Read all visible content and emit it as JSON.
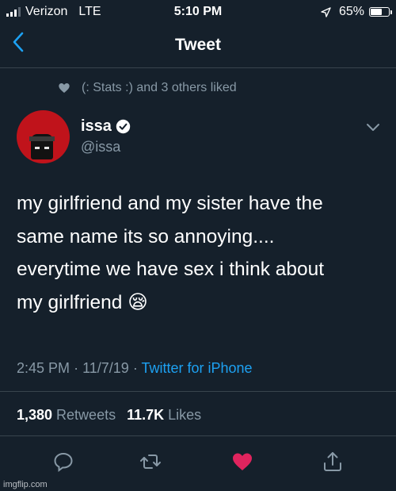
{
  "status_bar": {
    "carrier": "Verizon",
    "network": "LTE",
    "time": "5:10 PM",
    "battery_percent": "65%",
    "battery_level": 0.65
  },
  "nav": {
    "title": "Tweet",
    "back_icon": "chevron-left-icon"
  },
  "social_context": {
    "icon": "heart-icon",
    "text": "(: Stats :) and 3 others liked"
  },
  "author": {
    "name": "issa",
    "handle": "@issa",
    "verified": true,
    "avatar_bg": "#c0131b"
  },
  "tweet": {
    "lines": [
      "my girlfriend and my sister have the",
      "same name its so annoying....",
      "everytime we have sex i think about",
      "my girlfriend 😪"
    ],
    "time": "2:45 PM",
    "date": "11/7/19",
    "source": "Twitter for iPhone"
  },
  "stats": {
    "retweets_count": "1,380",
    "retweets_label": "Retweets",
    "likes_count": "11.7K",
    "likes_label": "Likes"
  },
  "actions": {
    "reply_icon": "reply-icon",
    "retweet_icon": "retweet-icon",
    "like_icon": "heart-filled-icon",
    "share_icon": "share-icon",
    "liked_color": "#e0245e"
  },
  "colors": {
    "background": "#15202b",
    "accent": "#1da1f2",
    "secondary_text": "#8899a6"
  },
  "watermark": "imgflip.com"
}
